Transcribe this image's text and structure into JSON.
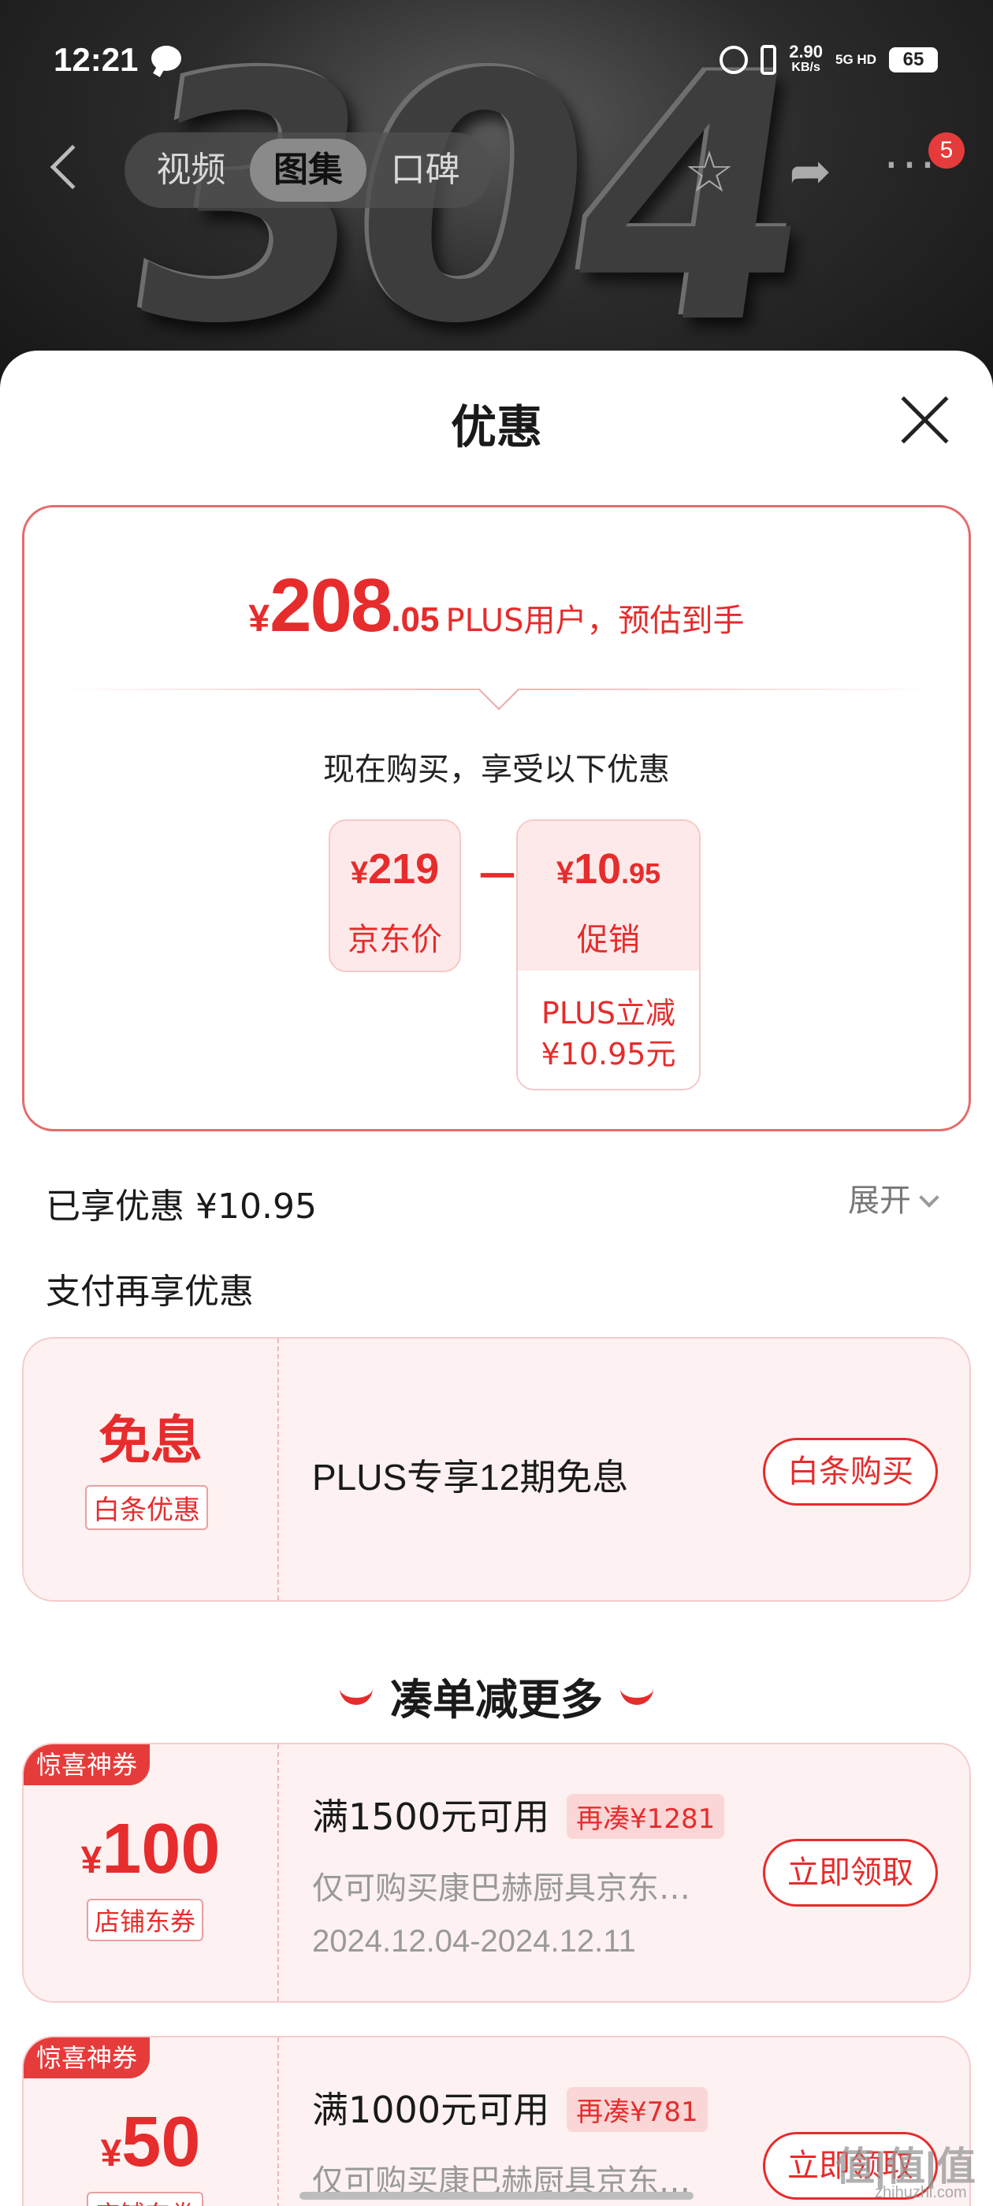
{
  "status_bar": {
    "time": "12:21",
    "speed": "2.90",
    "speed_unit": "KB/s",
    "network": "5G HD",
    "battery": "65"
  },
  "nav": {
    "tabs": [
      {
        "label": "视频"
      },
      {
        "label": "图集",
        "active": true
      },
      {
        "label": "口碑"
      }
    ],
    "more_badge": "5",
    "icons": [
      "back-icon",
      "star-icon",
      "share-icon",
      "more-icon"
    ]
  },
  "product_art_text": "304",
  "sheet": {
    "title": "优惠",
    "final_price": {
      "currency": "¥",
      "integer": "208",
      "decimal": ".05",
      "note": "PLUS用户，预估到手"
    },
    "buy_now_text": "现在购买，享受以下优惠",
    "jd_price": {
      "currency": "¥",
      "amount": "219",
      "label": "京东价"
    },
    "minus": "－",
    "promo": {
      "currency": "¥",
      "integer": "10",
      "decimal": ".95",
      "label": "促销",
      "detail_line1": "PLUS立减",
      "detail_line2": "¥10.95元"
    },
    "enjoyed": "已享优惠 ¥10.95",
    "expand": "展开",
    "pay_more": "支付再享优惠",
    "interest_free": {
      "big": "免息",
      "tag": "白条优惠",
      "text": "PLUS专享12期免息",
      "button": "白条购买"
    },
    "more_title": "凑单减更多",
    "coupons": [
      {
        "badge": "惊喜神券",
        "currency": "¥",
        "amount": "100",
        "tag": "店铺东券",
        "condition": "满1500元可用",
        "need": "再凑¥1281",
        "desc": "仅可购买康巴赫厨具京东…",
        "date": "2024.12.04-2024.12.11",
        "button": "立即领取"
      },
      {
        "badge": "惊喜神券",
        "currency": "¥",
        "amount": "50",
        "tag": "店铺东券",
        "condition": "满1000元可用",
        "need": "再凑¥781",
        "desc": "仅可购买康巴赫厨具京东…",
        "button": "立即领取"
      }
    ]
  },
  "watermark": {
    "main": "值|值|值",
    "sub": "zhihuzhi.com"
  },
  "colors": {
    "accent": "#e62c2c",
    "coupon_bg": "#fdf1f1",
    "pill_bg": "#fde9e9"
  }
}
